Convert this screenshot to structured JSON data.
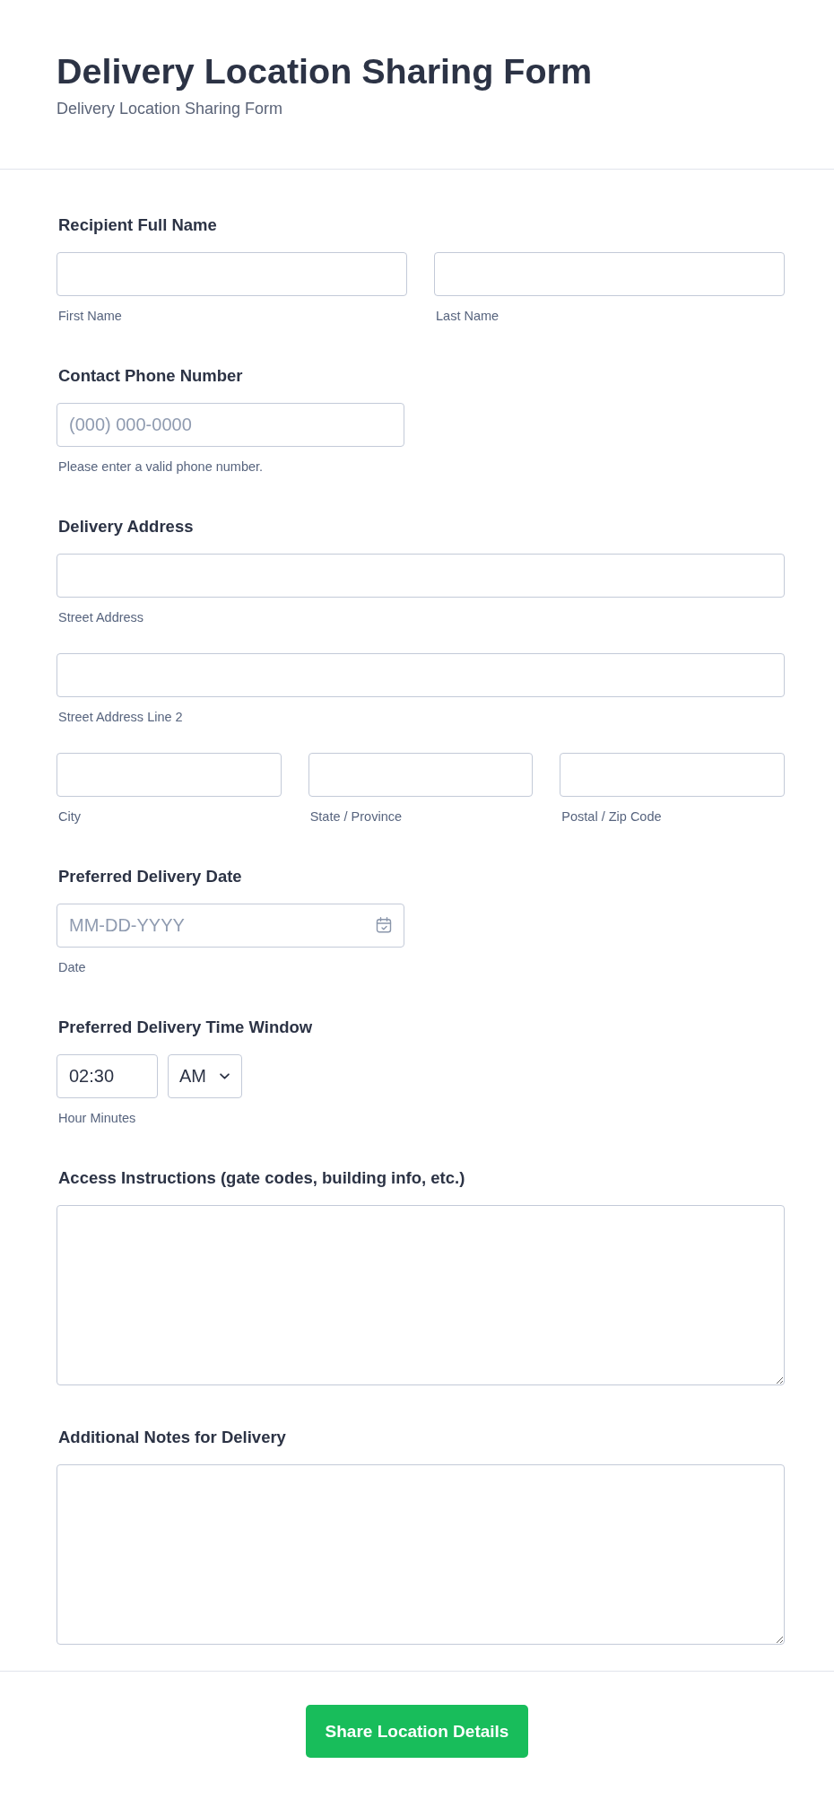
{
  "header": {
    "title": "Delivery Location Sharing Form",
    "subtitle": "Delivery Location Sharing Form"
  },
  "fields": [
    {
      "kind": "inputs",
      "label": "Recipient Full Name",
      "rows": [
        [
          {
            "sublabel": "First Name"
          },
          {
            "sublabel": "Last Name"
          }
        ]
      ]
    },
    {
      "kind": "phone",
      "label": "Contact Phone Number",
      "placeholder": "(000) 000-0000",
      "hint": "Please enter a valid phone number."
    },
    {
      "kind": "inputs",
      "label": "Delivery Address",
      "rows": [
        [
          {
            "sublabel": "Street Address"
          }
        ],
        [
          {
            "sublabel": "Street Address Line 2"
          }
        ],
        [
          {
            "sublabel": "City"
          },
          {
            "sublabel": "State / Province"
          },
          {
            "sublabel": "Postal / Zip Code"
          }
        ]
      ]
    },
    {
      "kind": "date",
      "label": "Preferred Delivery Date",
      "placeholder": "MM-DD-YYYY",
      "sublabel": "Date"
    },
    {
      "kind": "time",
      "label": "Preferred Delivery Time Window",
      "value": "02:30",
      "period": "AM",
      "sublabel": "Hour Minutes"
    },
    {
      "kind": "textarea",
      "label": "Access Instructions (gate codes, building info, etc.)"
    },
    {
      "kind": "textarea",
      "label": "Additional Notes for Delivery"
    }
  ],
  "submit": {
    "label": "Share Location Details"
  }
}
